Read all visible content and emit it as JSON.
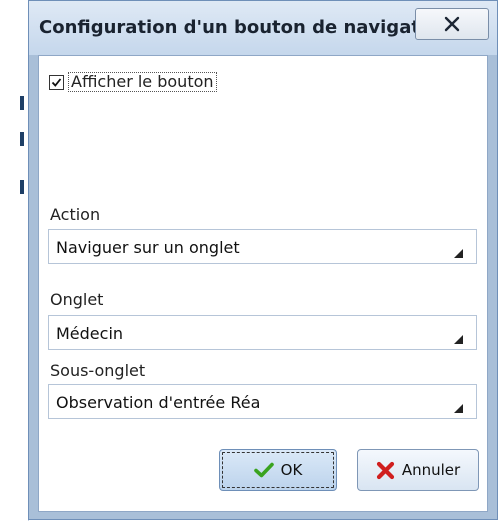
{
  "window": {
    "title": "Configuration d'un bouton de navigati..."
  },
  "options": {
    "show_button_label": "Afficher le bouton",
    "show_button_checked": true
  },
  "fields": {
    "action": {
      "label": "Action",
      "value": "Naviguer sur un onglet"
    },
    "tab": {
      "label": "Onglet",
      "value": "Médecin"
    },
    "subtab": {
      "label": "Sous-onglet",
      "value": "Observation d'entrée Réa"
    }
  },
  "buttons": {
    "ok_label": "OK",
    "cancel_label": "Annuler"
  },
  "icons": {
    "close": "close-icon",
    "check": "checkmark-icon",
    "cancel": "red-x-icon",
    "dropdown": "dropdown-arrow-icon"
  },
  "colors": {
    "title_bar": "#c5d7ec",
    "frame": "#a9bfd8",
    "ok_icon": "#3aa31f",
    "cancel_icon": "#d01f1f"
  }
}
